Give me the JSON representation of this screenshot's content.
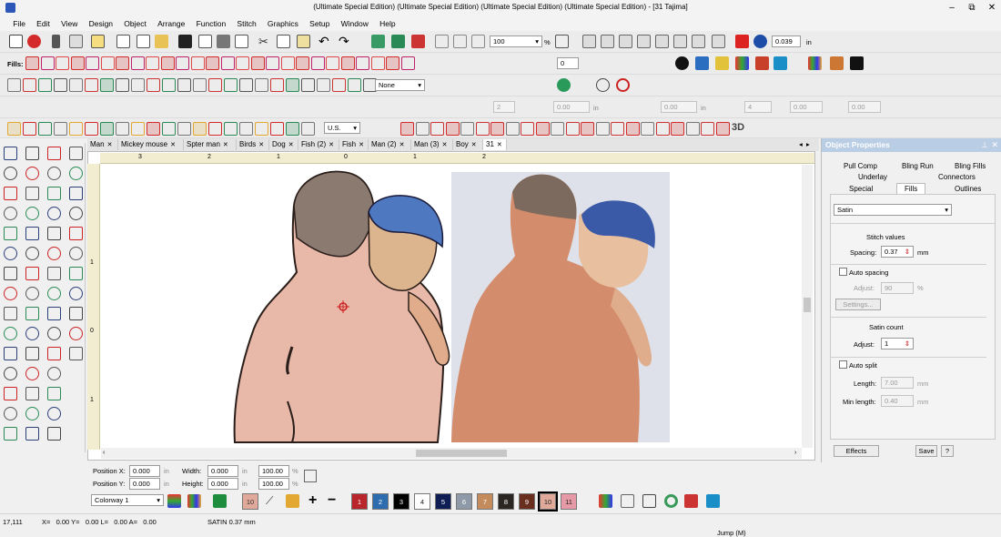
{
  "title": "(Ultimate Special Edition) (Ultimate Special Edition) (Ultimate Special Edition) (Ultimate Special Edition) - [31        Tajima]",
  "window_controls": [
    "–",
    "⧉",
    "✕"
  ],
  "menu": [
    "File",
    "Edit",
    "View",
    "Design",
    "Object",
    "Arrange",
    "Function",
    "Stitch",
    "Graphics",
    "Setup",
    "Window",
    "Help"
  ],
  "toolbar": {
    "zoom": "100",
    "zoom_unit": "%",
    "stitch_size": "0.039",
    "stitch_unit": "in",
    "fills_label": "Fills:",
    "rotate_value": "0",
    "none_select": "None",
    "ref_value": "2",
    "spacing_values": [
      "0.00",
      "0.00",
      "4",
      "0.00",
      "0.00"
    ],
    "spacing_units": [
      "in",
      "in",
      "in",
      "in"
    ],
    "units_select": "U.S.",
    "threed_label": "3D"
  },
  "tabs": [
    "Man",
    "Mickey mouse",
    "Spter man",
    "Birds",
    "Dog",
    "Fish (2)",
    "Fish",
    "Man (2)",
    "Man (3)",
    "Boy",
    "31"
  ],
  "ruler_h": [
    "3",
    "2",
    "1",
    "0",
    "1",
    "2"
  ],
  "ruler_v": [
    "1",
    "0",
    "1"
  ],
  "object_properties": {
    "header": "Object Properties",
    "tabs_row1": [
      "Pull Comp",
      "Bling Run",
      "Bling Fills"
    ],
    "tabs_row2": [
      "Underlay",
      "Connectors"
    ],
    "tabs_row3": [
      "Special",
      "Fills",
      "Outlines"
    ],
    "fill_type": "Satin",
    "stitch_values_label": "Stitch values",
    "spacing_label": "Spacing:",
    "spacing_value": "0.37",
    "spacing_unit": "mm",
    "auto_spacing_label": "Auto spacing",
    "adjust_label": "Adjust:",
    "adjust_value": "90",
    "adjust_unit": "%",
    "settings_label": "Settings...",
    "satin_count_label": "Satin count",
    "satin_adjust_label": "Adjust:",
    "satin_adjust_value": "1",
    "auto_split_label": "Auto split",
    "length_label": "Length:",
    "length_value": "7.00",
    "length_unit": "mm",
    "min_length_label": "Min length:",
    "min_length_value": "0.40",
    "min_length_unit": "mm",
    "effects_button": "Effects",
    "save_button": "Save",
    "help_button": "?"
  },
  "position": {
    "pos_x_label": "Position X:",
    "pos_x": "0.000",
    "pos_x_unit": "in",
    "pos_y_label": "Position Y:",
    "pos_y": "0.000",
    "pos_y_unit": "in",
    "width_label": "Width:",
    "width": "0.000",
    "width_unit": "in",
    "height_label": "Height:",
    "height": "0.000",
    "height_unit": "in",
    "scale_w": "100.00",
    "scale_h": "100.00",
    "scale_unit": "%"
  },
  "colorbar": {
    "colorway": "Colorway 1",
    "current_swatch": "10",
    "swatches": [
      {
        "n": "1",
        "color": "#b8262b"
      },
      {
        "n": "2",
        "color": "#2d6cae"
      },
      {
        "n": "3",
        "color": "#000000"
      },
      {
        "n": "4",
        "color": "#ffffff"
      },
      {
        "n": "5",
        "color": "#0e1d54"
      },
      {
        "n": "6",
        "color": "#8f9aa8"
      },
      {
        "n": "7",
        "color": "#c48b5c"
      },
      {
        "n": "8",
        "color": "#2b2622"
      },
      {
        "n": "9",
        "color": "#6a2e1f"
      },
      {
        "n": "10",
        "color": "#e0a99a"
      },
      {
        "n": "11",
        "color": "#e69aa8"
      }
    ]
  },
  "status": {
    "stitch_count": "17,111",
    "coords": "X=   0.00 Y=   0.00 L=   0.00 A=   0.00",
    "stitch_info": "SATIN 0.37 mm",
    "mode": "Jump (M)"
  }
}
